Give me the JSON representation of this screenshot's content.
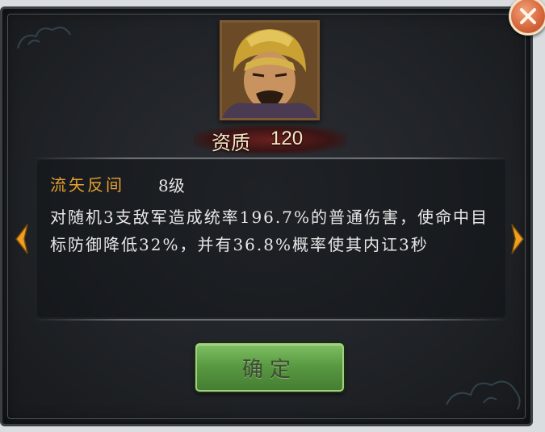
{
  "general": {
    "aptitude_label": "资质",
    "aptitude_value": "120"
  },
  "skill": {
    "name": "流矢反间",
    "level": "8级",
    "description": "对随机3支敌军造成统率196.7%的普通伤害，使命中目标防御降低32%，并有36.8%概率使其内讧3秒"
  },
  "buttons": {
    "confirm_label": "确定"
  },
  "icons": {
    "close": "close-icon",
    "prev": "arrow-left-icon",
    "next": "arrow-right-icon",
    "portrait": "general-portrait"
  },
  "colors": {
    "skill_name": "#e6a030",
    "text": "#e8e8e8",
    "button_green": "#5a9a42",
    "close_orange": "#d8693e",
    "arrow_orange": "#f0a020"
  }
}
